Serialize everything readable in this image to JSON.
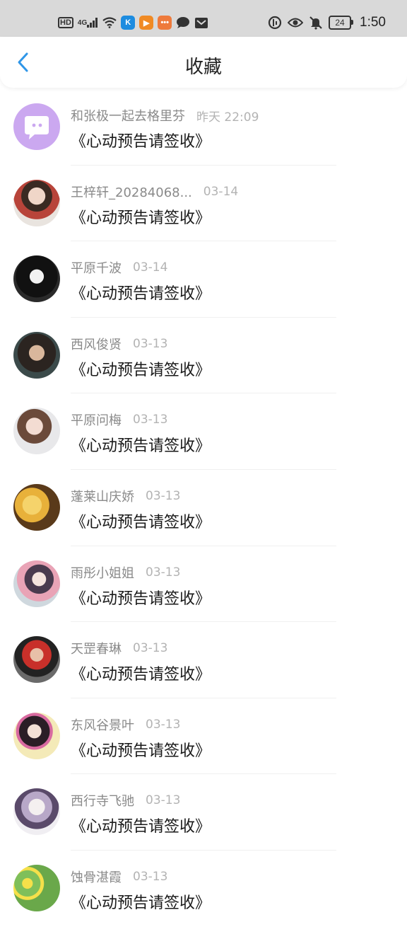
{
  "status_bar": {
    "left_icons": [
      "hd-icon",
      "4g-signal-icon",
      "wifi-icon",
      "k-app-icon",
      "play-app-icon",
      "chat-app-icon",
      "message-bubble-icon",
      "inbox-icon"
    ],
    "hd": "HD",
    "net": "4G",
    "battery": "24",
    "time": "1:50"
  },
  "header": {
    "title": "收藏",
    "back_icon": "chevron-left-icon",
    "accent": "#2f96e8"
  },
  "items": [
    {
      "name": "和张极一起去格里芬",
      "time": "昨天 22:09",
      "message": "《心动预告请签收》",
      "avatar": "message-bubble-avatar"
    },
    {
      "name": "王梓轩_20284068...",
      "time": "03-14",
      "message": "《心动预告请签收》",
      "avatar": "user-avatar"
    },
    {
      "name": "平原千波",
      "time": "03-14",
      "message": "《心动预告请签收》",
      "avatar": "user-avatar"
    },
    {
      "name": "西风俊贤",
      "time": "03-13",
      "message": "《心动预告请签收》",
      "avatar": "user-avatar"
    },
    {
      "name": "平原问梅",
      "time": "03-13",
      "message": "《心动预告请签收》",
      "avatar": "user-avatar"
    },
    {
      "name": "蓬莱山庆娇",
      "time": "03-13",
      "message": "《心动预告请签收》",
      "avatar": "user-avatar"
    },
    {
      "name": "雨彤小姐姐",
      "time": "03-13",
      "message": "《心动预告请签收》",
      "avatar": "user-avatar"
    },
    {
      "name": "天罡春琳",
      "time": "03-13",
      "message": "《心动预告请签收》",
      "avatar": "user-avatar"
    },
    {
      "name": "东风谷景叶",
      "time": "03-13",
      "message": "《心动预告请签收》",
      "avatar": "user-avatar"
    },
    {
      "name": "西行寺飞驰",
      "time": "03-13",
      "message": "《心动预告请签收》",
      "avatar": "user-avatar"
    },
    {
      "name": "蚀骨湛霞",
      "time": "03-13",
      "message": "《心动预告请签收》",
      "avatar": "user-avatar"
    }
  ]
}
